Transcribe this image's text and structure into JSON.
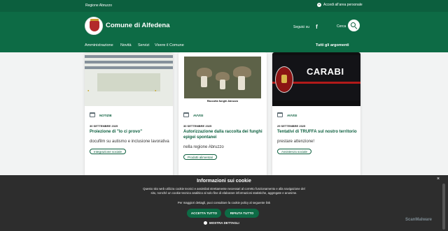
{
  "slim_header": {
    "region": "Regione Abruzzo",
    "login": "Accedi all'area personale"
  },
  "header": {
    "brand": "Comune di Alfedena",
    "follow_label": "Seguici su",
    "search_label": "Cerca"
  },
  "nav": {
    "items": [
      "Amministrazione",
      "Novità",
      "Servizi",
      "Vivere il Comune"
    ],
    "all_topics": "Tutti gli argomenti"
  },
  "cards": [
    {
      "category": "NOTIZIE",
      "date": "30 SETTEMBRE 2025",
      "title": "Proiezione di \"Io ci provo\"",
      "description": "docufilm su autismo e inclusione lavorativa",
      "tag": "Integrazione sociale"
    },
    {
      "category": "AVVISI",
      "date": "30 SETTEMBRE 2025",
      "title": "Autorizzazione dalla raccolta dei funghi epigei spontanei",
      "description": "nella regione Abruzzo",
      "tag": "Prodotti alimentari",
      "image_caption": "Raccolta funghi Abruzzo"
    },
    {
      "category": "AVVISI",
      "date": "29 SETTEMBRE 2025",
      "title": "Tentativi di TRUFFA sul nostro territorio",
      "description": "prestare attenzione!",
      "tag": "Assistenza sociale",
      "image_text": "CARABI"
    }
  ],
  "cookie_banner": {
    "title": "Informazioni sui cookie",
    "text": "Questo sito web utilizza cookie tecnici e assimilati strettamente necessari al corretto funzionamento e alla navigazione del sito, nonché un cookie tecnico analitico al solo fine di elaborare informazioni statistiche, aggregate e anonime.",
    "more": "Per maggiori dettagli, puoi consultare la cookie policy al seguente link",
    "accept": "ACCETTA TUTTO",
    "reject": "RIFIUTA TUTTO",
    "details": "MOSTRA DETTAGLI",
    "close": "×",
    "watermark": "ScanMalware"
  },
  "colors": {
    "primary": "#0d6b45",
    "slim": "#0c5f3e",
    "banner": "#2d2d2d"
  }
}
